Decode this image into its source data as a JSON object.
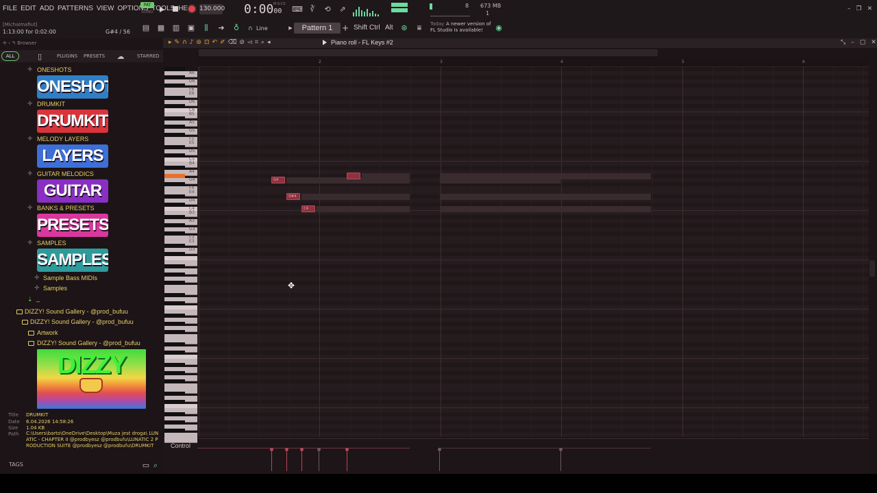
{
  "topbar": {
    "menus": [
      "FILE",
      "EDIT",
      "ADD",
      "PATTERNS",
      "VIEW",
      "OPTIONS",
      "TOOLS",
      "HELP"
    ],
    "pat_label": "PAT",
    "song_label": "SONG",
    "tempo": "130.000",
    "time_main": "0:00",
    "time_sub": "00",
    "time_unit": "M:S:CS",
    "polyphony": "8",
    "memory": "673 MB",
    "memory_sub": "1",
    "colors": {
      "accent": "#6fc86f",
      "record": "#e0444e",
      "meter": "#6fd9a0"
    }
  },
  "hintbar": {
    "user": "[Michalmafiut]",
    "position": "1:13:00 for 0:02:00",
    "note": "G#4 / 56",
    "snap": "Line",
    "pattern": "Pattern 1",
    "modifiers": [
      "Shift",
      "Ctrl",
      "Alt"
    ],
    "news_when": "Today",
    "news_line1": "A newer version of",
    "news_line2": "FL Studio is available!"
  },
  "browser": {
    "header": "Browser",
    "tabs": {
      "all": "ALL",
      "plugins": "PLUGINS",
      "presets": "PRESETS",
      "starred": "STARRED"
    },
    "packs": [
      {
        "label": "ONESHOTS",
        "thumb": "ONESHOTS",
        "bg": "#2f7fc7"
      },
      {
        "label": "DRUMKIT",
        "thumb": "DRUMKIT",
        "bg": "#d8343c"
      },
      {
        "label": "MELODY LAYERS",
        "thumb": "LAYERS",
        "bg": "#3d6fd6"
      },
      {
        "label": "GUITAR MELODICS",
        "thumb": "GUITAR",
        "bg": "#8a2fc4"
      },
      {
        "label": "BANKS & PRESETS",
        "thumb": "PRESETS",
        "bg": "#d8389c"
      },
      {
        "label": "SAMPLES",
        "thumb": "SAMPLES",
        "bg": "#2e9b9b"
      }
    ],
    "sub_items": [
      "Sample Bass MIDIs",
      "Samples"
    ],
    "more_marker": "_",
    "folders": [
      "DIZZY! Sound Gallery - @prod_bufuu",
      "DIZZY! Sound Gallery - @prod_bufuu",
      "Artwork",
      "DIZZY! Sound Gallery - @prod_bufuu"
    ],
    "cover_title": "DIZZY",
    "info": {
      "title_k": "Title",
      "title_v": "DRUMKIT",
      "date_k": "Date",
      "date_v": "6.04.2026 14:58:26",
      "size_k": "Size",
      "size_v": "1.04 KB",
      "path_k": "Path",
      "path_v": "C:\\Users\\barto\\OneDrive\\Desktop\\Muza jest droga\\ LUNATIC - CHAPTER II @prodbyesz @prodbufu\\LUNATIC 2 PRODUCTION SUITE @prodbyesz @prodbufu\\DRUMKIT"
    },
    "tags": "TAGS"
  },
  "piano_roll": {
    "title": "Piano roll - FL Keys #2",
    "bar_numbers": [
      "2",
      "3",
      "4",
      "5",
      "6"
    ],
    "key_labels": [
      "A6",
      "G6",
      "F6",
      "E6",
      "D6",
      "C6",
      "B5",
      "A5",
      "G5",
      "F5",
      "E5",
      "D5",
      "C5",
      "B4",
      "A4",
      "G4",
      "F4",
      "E4",
      "D4",
      "C4",
      "B3",
      "A3",
      "G3",
      "F3",
      "E3",
      "D3"
    ],
    "notes": [
      {
        "label": "G4",
        "pitch": "G4",
        "start_beat": 3.0,
        "length_beats": 1.0
      },
      {
        "label": "D#4",
        "pitch": "D#4",
        "start_beat": 4.0,
        "length_beats": 1.0
      },
      {
        "label": "C4",
        "pitch": "C4",
        "start_beat": 5.0,
        "length_beats": 1.0
      },
      {
        "label": "",
        "pitch": "G#4",
        "start_beat": 8.0,
        "length_beats": 1.0
      }
    ],
    "highlight_key": "G#4",
    "control_label": "Control",
    "colors": {
      "note": "#8f3240",
      "highlight_key": "#e8702a"
    }
  }
}
